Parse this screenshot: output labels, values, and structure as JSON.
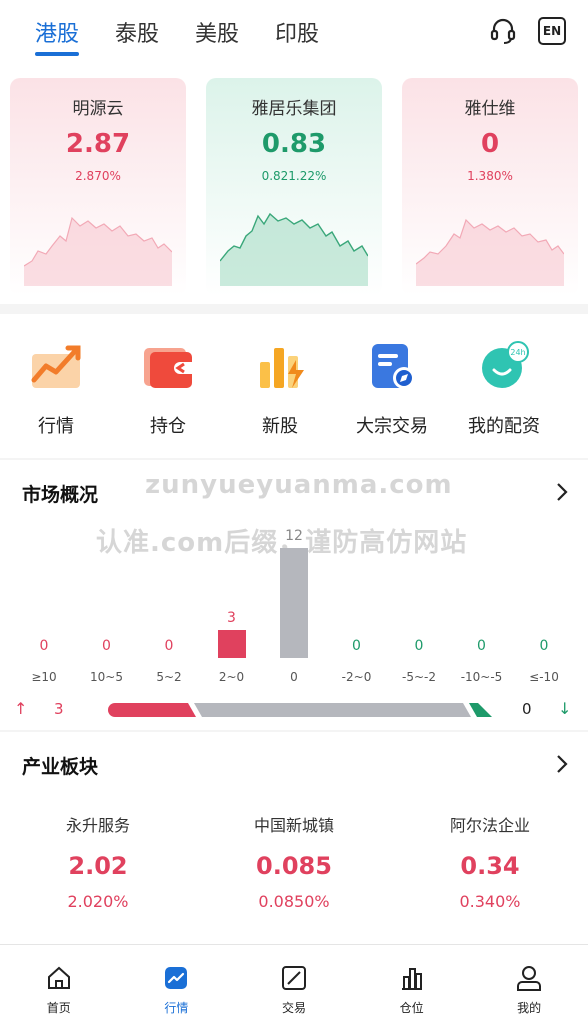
{
  "top_tabs": [
    {
      "label": "港股",
      "active": true
    },
    {
      "label": "泰股",
      "active": false
    },
    {
      "label": "美股",
      "active": false
    },
    {
      "label": "印股",
      "active": false
    }
  ],
  "top_icons": {
    "support": "headset-icon",
    "language": "EN"
  },
  "index_cards": [
    {
      "name": "明源云",
      "price": "2.87",
      "change": "2.870%",
      "trend": "up"
    },
    {
      "name": "雅居乐集团",
      "price": "0.83",
      "change": "0.821.22%",
      "trend": "down"
    },
    {
      "name": "雅仕维",
      "price": "0",
      "change": "1.380%",
      "trend": "up"
    }
  ],
  "functions": [
    {
      "label": "行情",
      "icon": "trend-chart-icon"
    },
    {
      "label": "持仓",
      "icon": "wallet-icon"
    },
    {
      "label": "新股",
      "icon": "bar-lightning-icon"
    },
    {
      "label": "大宗交易",
      "icon": "document-compass-icon"
    },
    {
      "label": "我的配资",
      "icon": "chat-24h-icon"
    }
  ],
  "market": {
    "title": "市场概况",
    "buckets": [
      {
        "label": "≥10",
        "count": 0,
        "kind": "up"
      },
      {
        "label": "10~5",
        "count": 0,
        "kind": "up"
      },
      {
        "label": "5~2",
        "count": 0,
        "kind": "up"
      },
      {
        "label": "2~0",
        "count": 3,
        "kind": "up"
      },
      {
        "label": "0",
        "count": 12,
        "kind": "flat"
      },
      {
        "label": "-2~0",
        "count": 0,
        "kind": "down"
      },
      {
        "label": "-5~-2",
        "count": 0,
        "kind": "down"
      },
      {
        "label": "-10~-5",
        "count": 0,
        "kind": "down"
      },
      {
        "label": "≤-10",
        "count": 0,
        "kind": "down"
      }
    ],
    "up_total": "3",
    "down_total": "0"
  },
  "watermark": {
    "line1": "zunyueyuanma.com",
    "line2": "认准.com后缀，谨防高仿网站"
  },
  "sectors_block": {
    "title": "产业板块",
    "items": [
      {
        "name": "永升服务",
        "price": "2.02",
        "change": "2.020%"
      },
      {
        "name": "中国新城镇",
        "price": "0.085",
        "change": "0.0850%"
      },
      {
        "name": "阿尔法企业",
        "price": "0.34",
        "change": "0.340%"
      }
    ]
  },
  "bottom_nav": [
    {
      "label": "首页",
      "icon": "home-icon",
      "active": false
    },
    {
      "label": "行情",
      "icon": "market-icon",
      "active": true
    },
    {
      "label": "交易",
      "icon": "trade-icon",
      "active": false
    },
    {
      "label": "仓位",
      "icon": "position-icon",
      "active": false
    },
    {
      "label": "我的",
      "icon": "user-icon",
      "active": false
    }
  ],
  "colors": {
    "accent": "#1a6fd6",
    "up": "#e0415e",
    "down": "#1e9a6a",
    "flat": "#b5b7bd"
  }
}
